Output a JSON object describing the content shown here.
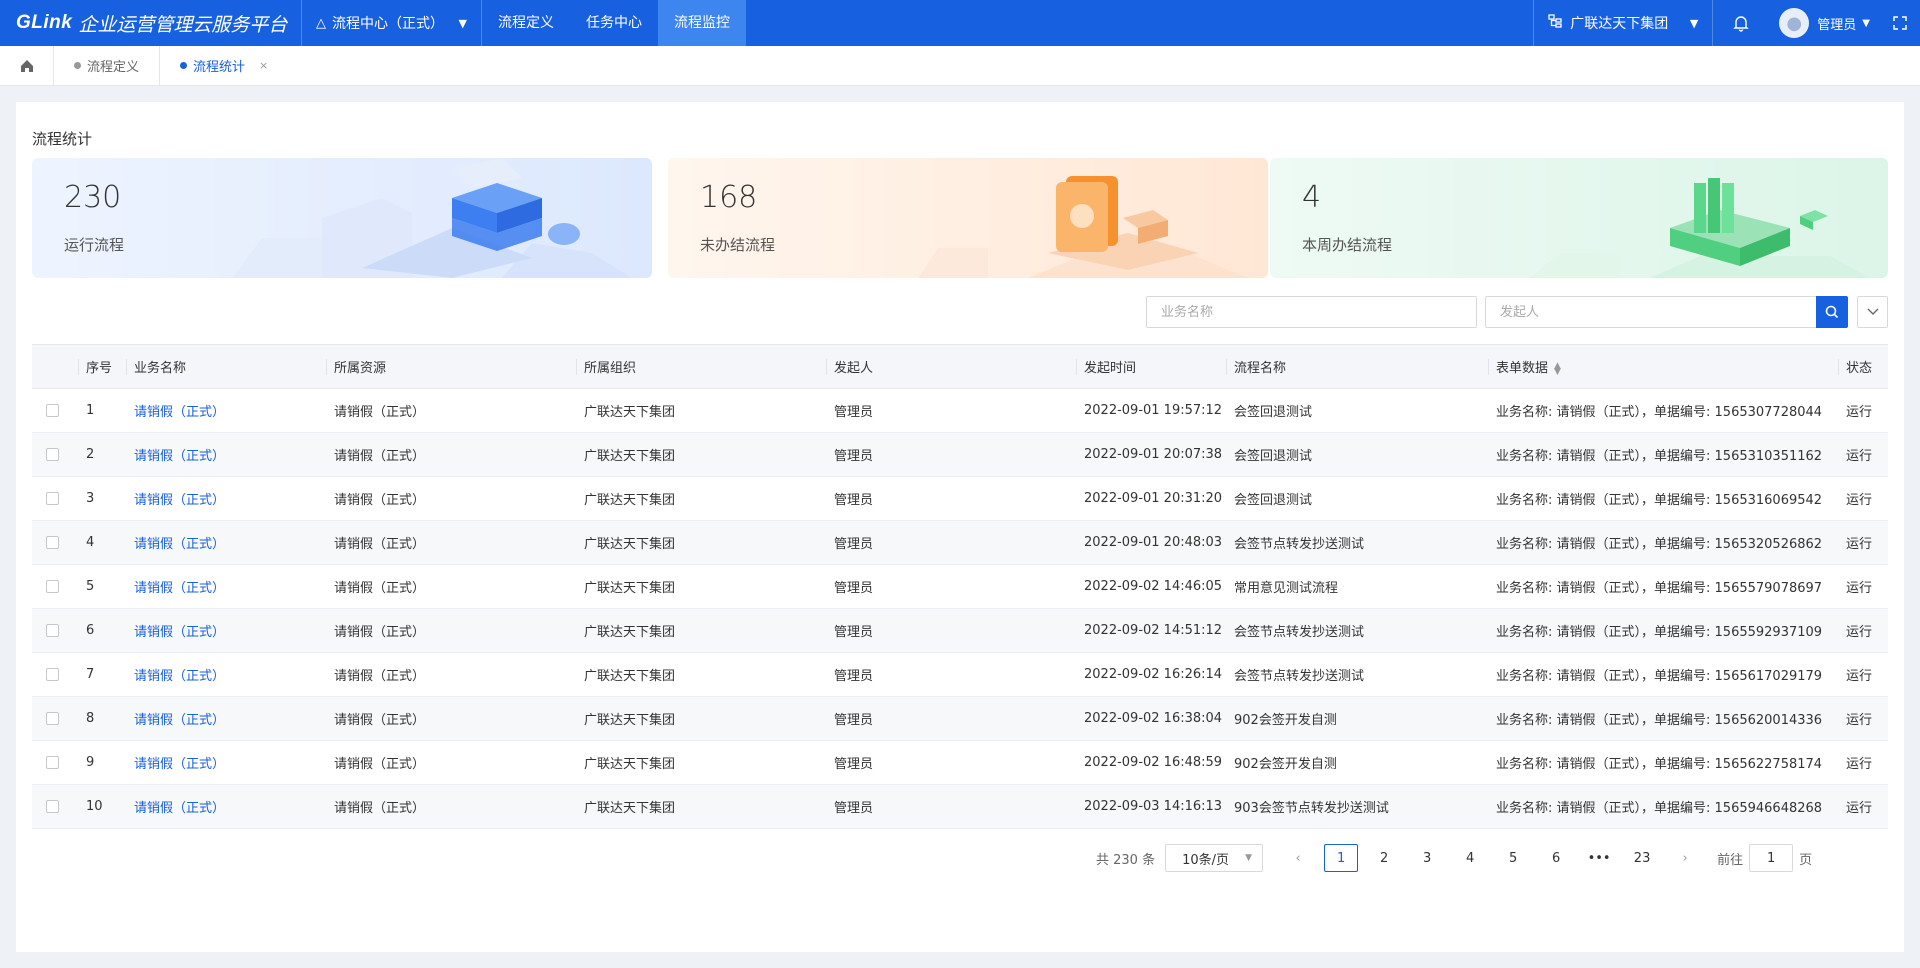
{
  "topbar": {
    "logo": "GLink",
    "platform_title": "企业运营管理云服务平台",
    "app_switch": "流程中心（正式）",
    "nav": [
      "流程定义",
      "任务中心",
      "流程监控"
    ],
    "active_nav": "流程监控",
    "org": "广联达天下集团",
    "user": "管理员"
  },
  "tabs": {
    "items": [
      "流程定义",
      "流程统计"
    ],
    "active": "流程统计",
    "close": "×"
  },
  "page": {
    "title": "流程统计"
  },
  "stats": [
    {
      "value": "230",
      "label": "运行流程"
    },
    {
      "value": "168",
      "label": "未办结流程"
    },
    {
      "value": "4",
      "label": "本周办结流程"
    }
  ],
  "search": {
    "business_placeholder": "业务名称",
    "initiator_placeholder": "发起人"
  },
  "table": {
    "headers": {
      "index": "序号",
      "business": "业务名称",
      "resource": "所属资源",
      "org": "所属组织",
      "initiator": "发起人",
      "time": "发起时间",
      "process": "流程名称",
      "form": "表单数据",
      "status": "状态"
    },
    "rows": [
      {
        "index": "1",
        "business": "请销假（正式）",
        "resource": "请销假（正式）",
        "org": "广联达天下集团",
        "initiator": "管理员",
        "time": "2022-09-01 19:57:12",
        "process": "会签回退测试",
        "form": "业务名称: 请销假（正式），单据编号: 1565307728044",
        "status": "运行"
      },
      {
        "index": "2",
        "business": "请销假（正式）",
        "resource": "请销假（正式）",
        "org": "广联达天下集团",
        "initiator": "管理员",
        "time": "2022-09-01 20:07:38",
        "process": "会签回退测试",
        "form": "业务名称: 请销假（正式），单据编号: 1565310351162",
        "status": "运行"
      },
      {
        "index": "3",
        "business": "请销假（正式）",
        "resource": "请销假（正式）",
        "org": "广联达天下集团",
        "initiator": "管理员",
        "time": "2022-09-01 20:31:20",
        "process": "会签回退测试",
        "form": "业务名称: 请销假（正式），单据编号: 1565316069542",
        "status": "运行"
      },
      {
        "index": "4",
        "business": "请销假（正式）",
        "resource": "请销假（正式）",
        "org": "广联达天下集团",
        "initiator": "管理员",
        "time": "2022-09-01 20:48:03",
        "process": "会签节点转发抄送测试",
        "form": "业务名称: 请销假（正式），单据编号: 1565320526862",
        "status": "运行"
      },
      {
        "index": "5",
        "business": "请销假（正式）",
        "resource": "请销假（正式）",
        "org": "广联达天下集团",
        "initiator": "管理员",
        "time": "2022-09-02 14:46:05",
        "process": "常用意见测试流程",
        "form": "业务名称: 请销假（正式），单据编号: 1565579078697",
        "status": "运行"
      },
      {
        "index": "6",
        "business": "请销假（正式）",
        "resource": "请销假（正式）",
        "org": "广联达天下集团",
        "initiator": "管理员",
        "time": "2022-09-02 14:51:12",
        "process": "会签节点转发抄送测试",
        "form": "业务名称: 请销假（正式），单据编号: 1565592937109",
        "status": "运行"
      },
      {
        "index": "7",
        "business": "请销假（正式）",
        "resource": "请销假（正式）",
        "org": "广联达天下集团",
        "initiator": "管理员",
        "time": "2022-09-02 16:26:14",
        "process": "会签节点转发抄送测试",
        "form": "业务名称: 请销假（正式），单据编号: 1565617029179",
        "status": "运行"
      },
      {
        "index": "8",
        "business": "请销假（正式）",
        "resource": "请销假（正式）",
        "org": "广联达天下集团",
        "initiator": "管理员",
        "time": "2022-09-02 16:38:04",
        "process": "902会签开发自测",
        "form": "业务名称: 请销假（正式），单据编号: 1565620014336",
        "status": "运行"
      },
      {
        "index": "9",
        "business": "请销假（正式）",
        "resource": "请销假（正式）",
        "org": "广联达天下集团",
        "initiator": "管理员",
        "time": "2022-09-02 16:48:59",
        "process": "902会签开发自测",
        "form": "业务名称: 请销假（正式），单据编号: 1565622758174",
        "status": "运行"
      },
      {
        "index": "10",
        "business": "请销假（正式）",
        "resource": "请销假（正式）",
        "org": "广联达天下集团",
        "initiator": "管理员",
        "time": "2022-09-03 14:16:13",
        "process": "903会签节点转发抄送测试",
        "form": "业务名称: 请销假（正式），单据编号: 1565946648268",
        "status": "运行"
      }
    ]
  },
  "pagination": {
    "total": "共 230 条",
    "page_size": "10条/页",
    "pages": [
      "1",
      "2",
      "3",
      "4",
      "5",
      "6",
      "•••",
      "23"
    ],
    "current": "1",
    "goto_label": "前往",
    "goto_value": "1",
    "page_unit": "页"
  },
  "colors": {
    "primary": "#1760e0",
    "topbar": "#1760e0",
    "active_nav": "#3d86f0"
  }
}
